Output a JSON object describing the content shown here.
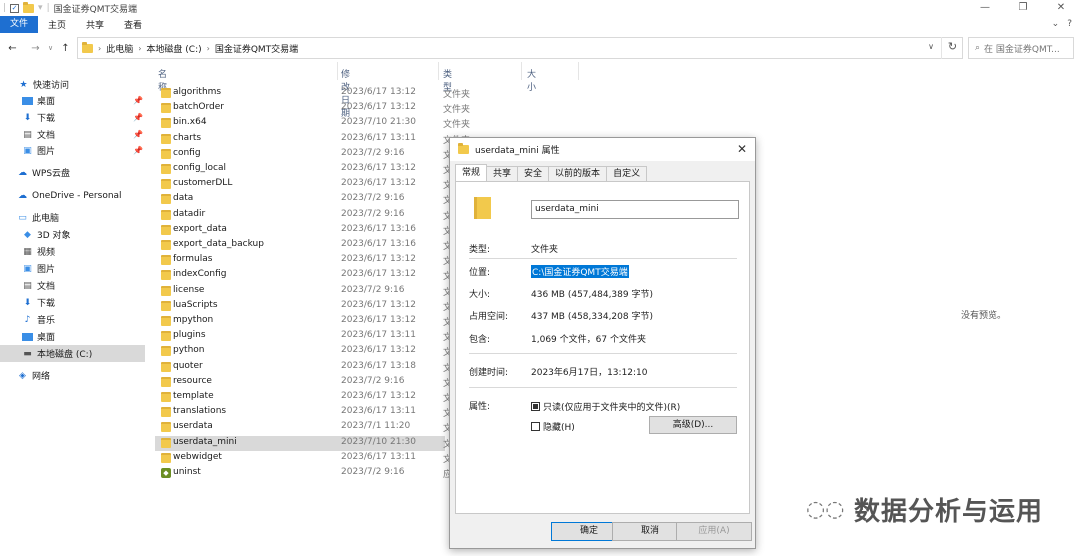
{
  "window": {
    "title": "国金证券QMT交易端",
    "controls": [
      "—",
      "❐",
      "✕"
    ]
  },
  "ribbon": {
    "tabs": [
      "文件",
      "主页",
      "共享",
      "查看"
    ]
  },
  "address": {
    "crumbs": [
      "此电脑",
      "本地磁盘 (C:)",
      "国金证券QMT交易端"
    ],
    "search_placeholder": "在 国金证券QMT..."
  },
  "sidebar": {
    "items": [
      {
        "label": "快速访问",
        "icon": "star-icon",
        "pinned": false
      },
      {
        "label": "桌面",
        "icon": "desktop-icon",
        "pinned": true
      },
      {
        "label": "下载",
        "icon": "download-icon",
        "pinned": true
      },
      {
        "label": "文档",
        "icon": "document-icon",
        "pinned": true
      },
      {
        "label": "图片",
        "icon": "picture-icon",
        "pinned": true
      },
      {
        "label": "WPS云盘",
        "icon": "cloud-icon",
        "pinned": false
      },
      {
        "label": "OneDrive - Personal",
        "icon": "onedrive-icon",
        "pinned": false
      },
      {
        "label": "此电脑",
        "icon": "computer-icon",
        "pinned": false
      },
      {
        "label": "3D 对象",
        "icon": "cube-icon",
        "pinned": false
      },
      {
        "label": "视频",
        "icon": "video-icon",
        "pinned": false
      },
      {
        "label": "图片",
        "icon": "picture-icon",
        "pinned": false
      },
      {
        "label": "文档",
        "icon": "document-icon",
        "pinned": false
      },
      {
        "label": "下载",
        "icon": "download-icon",
        "pinned": false
      },
      {
        "label": "音乐",
        "icon": "music-icon",
        "pinned": false
      },
      {
        "label": "桌面",
        "icon": "desktop-icon",
        "pinned": false
      },
      {
        "label": "本地磁盘 (C:)",
        "icon": "drive-icon",
        "pinned": false
      },
      {
        "label": "网络",
        "icon": "network-icon",
        "pinned": false
      }
    ]
  },
  "list": {
    "headers": {
      "name": "名称",
      "date": "修改日期",
      "type": "类型",
      "size": "大小"
    },
    "rows": [
      {
        "name": "algorithms",
        "date": "2023/6/17 13:12",
        "type": "文件夹",
        "icon": "folder"
      },
      {
        "name": "batchOrder",
        "date": "2023/6/17 13:12",
        "type": "文件夹",
        "icon": "folder"
      },
      {
        "name": "bin.x64",
        "date": "2023/7/10 21:30",
        "type": "文件夹",
        "icon": "folder"
      },
      {
        "name": "charts",
        "date": "2023/6/17 13:11",
        "type": "文件夹",
        "icon": "folder"
      },
      {
        "name": "config",
        "date": "2023/7/2 9:16",
        "type": "文",
        "icon": "folder"
      },
      {
        "name": "config_local",
        "date": "2023/6/17 13:12",
        "type": "文",
        "icon": "folder"
      },
      {
        "name": "customerDLL",
        "date": "2023/6/17 13:12",
        "type": "文",
        "icon": "folder"
      },
      {
        "name": "data",
        "date": "2023/7/2 9:16",
        "type": "文",
        "icon": "folder"
      },
      {
        "name": "datadir",
        "date": "2023/7/2 9:16",
        "type": "文",
        "icon": "folder"
      },
      {
        "name": "export_data",
        "date": "2023/6/17 13:16",
        "type": "文",
        "icon": "folder"
      },
      {
        "name": "export_data_backup",
        "date": "2023/6/17 13:16",
        "type": "文",
        "icon": "folder"
      },
      {
        "name": "formulas",
        "date": "2023/6/17 13:12",
        "type": "文",
        "icon": "folder"
      },
      {
        "name": "indexConfig",
        "date": "2023/6/17 13:12",
        "type": "文",
        "icon": "folder"
      },
      {
        "name": "license",
        "date": "2023/7/2 9:16",
        "type": "文",
        "icon": "folder"
      },
      {
        "name": "luaScripts",
        "date": "2023/6/17 13:12",
        "type": "文",
        "icon": "folder"
      },
      {
        "name": "mpython",
        "date": "2023/6/17 13:12",
        "type": "文",
        "icon": "folder"
      },
      {
        "name": "plugins",
        "date": "2023/6/17 13:11",
        "type": "文",
        "icon": "folder"
      },
      {
        "name": "python",
        "date": "2023/6/17 13:12",
        "type": "文",
        "icon": "folder"
      },
      {
        "name": "quoter",
        "date": "2023/6/17 13:18",
        "type": "文",
        "icon": "folder"
      },
      {
        "name": "resource",
        "date": "2023/7/2 9:16",
        "type": "文",
        "icon": "folder"
      },
      {
        "name": "template",
        "date": "2023/6/17 13:12",
        "type": "文",
        "icon": "folder"
      },
      {
        "name": "translations",
        "date": "2023/6/17 13:11",
        "type": "文",
        "icon": "folder"
      },
      {
        "name": "userdata",
        "date": "2023/7/1 11:20",
        "type": "文",
        "icon": "folder"
      },
      {
        "name": "userdata_mini",
        "date": "2023/7/10 21:30",
        "type": "文",
        "icon": "folder",
        "selected": true
      },
      {
        "name": "webwidget",
        "date": "2023/6/17 13:11",
        "type": "文",
        "icon": "folder"
      },
      {
        "name": "uninst",
        "date": "2023/7/2 9:16",
        "type": "应",
        "icon": "exe"
      }
    ]
  },
  "preview": {
    "text": "没有预览。"
  },
  "dialog": {
    "title": "userdata_mini 属性",
    "tabs": [
      "常规",
      "共享",
      "安全",
      "以前的版本",
      "自定义"
    ],
    "name_value": "userdata_mini",
    "props": [
      {
        "label": "类型:",
        "value": "文件夹"
      },
      {
        "label": "位置:",
        "value": "C:\\国金证券QMT交易端"
      },
      {
        "label": "大小:",
        "value": "436 MB (457,484,389 字节)"
      },
      {
        "label": "占用空间:",
        "value": "437 MB (458,334,208 字节)"
      },
      {
        "label": "包含:",
        "value": "1,069 个文件，67 个文件夹"
      },
      {
        "label": "创建时间:",
        "value": "2023年6月17日，13:12:10"
      },
      {
        "label": "属性:",
        "value": ""
      }
    ],
    "readonly_label": "只读(仅应用于文件夹中的文件)(R)",
    "hidden_label": "隐藏(H)",
    "advanced_label": "高级(D)...",
    "ok_label": "确定",
    "cancel_label": "取消",
    "apply_label": "应用(A)"
  },
  "watermark": {
    "text": "数据分析与运用"
  }
}
